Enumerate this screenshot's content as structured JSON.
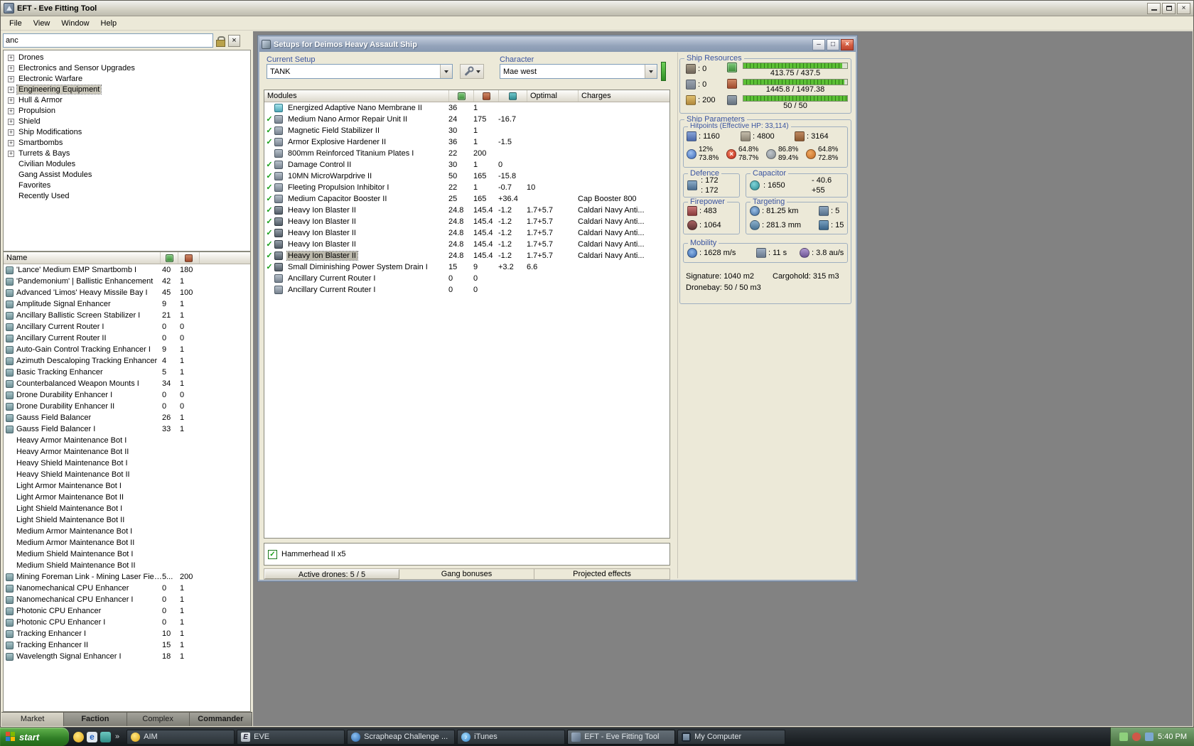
{
  "window": {
    "title": "EFT - Eve Fitting Tool",
    "menu": [
      "File",
      "View",
      "Window",
      "Help"
    ]
  },
  "sidebar": {
    "search_value": "anc",
    "tree": [
      {
        "label": "Drones",
        "exp": true
      },
      {
        "label": "Electronics and Sensor Upgrades",
        "exp": true
      },
      {
        "label": "Electronic Warfare",
        "exp": true
      },
      {
        "label": "Engineering Equipment",
        "exp": true,
        "selected": true
      },
      {
        "label": "Hull & Armor",
        "exp": true
      },
      {
        "label": "Propulsion",
        "exp": true
      },
      {
        "label": "Shield",
        "exp": true
      },
      {
        "label": "Ship Modifications",
        "exp": true
      },
      {
        "label": "Smartbombs",
        "exp": true
      },
      {
        "label": "Turrets & Bays",
        "exp": true
      },
      {
        "label": "Civilian Modules"
      },
      {
        "label": "Gang Assist Modules"
      },
      {
        "label": "Favorites"
      },
      {
        "label": "Recently Used"
      }
    ],
    "list": {
      "name_header": "Name",
      "items": [
        {
          "name": "'Lance' Medium EMP Smartbomb I",
          "v1": "40",
          "v2": "180"
        },
        {
          "name": "'Pandemonium' | Ballistic Enhancement",
          "v1": "42",
          "v2": "1"
        },
        {
          "name": "Advanced 'Limos' Heavy Missile Bay I",
          "v1": "45",
          "v2": "100"
        },
        {
          "name": "Amplitude Signal Enhancer",
          "v1": "9",
          "v2": "1"
        },
        {
          "name": "Ancillary Ballistic Screen Stabilizer I",
          "v1": "21",
          "v2": "1"
        },
        {
          "name": "Ancillary Current Router I",
          "v1": "0",
          "v2": "0"
        },
        {
          "name": "Ancillary Current Router II",
          "v1": "0",
          "v2": "0"
        },
        {
          "name": "Auto-Gain Control Tracking Enhancer I",
          "v1": "9",
          "v2": "1"
        },
        {
          "name": "Azimuth Descaloping Tracking Enhancer",
          "v1": "4",
          "v2": "1"
        },
        {
          "name": "Basic Tracking Enhancer",
          "v1": "5",
          "v2": "1"
        },
        {
          "name": "Counterbalanced Weapon Mounts I",
          "v1": "34",
          "v2": "1"
        },
        {
          "name": "Drone Durability Enhancer I",
          "v1": "0",
          "v2": "0"
        },
        {
          "name": "Drone Durability Enhancer II",
          "v1": "0",
          "v2": "0"
        },
        {
          "name": "Gauss Field Balancer",
          "v1": "26",
          "v2": "1"
        },
        {
          "name": "Gauss Field Balancer I",
          "v1": "33",
          "v2": "1"
        },
        {
          "name": "Heavy Armor Maintenance Bot I",
          "v1": "",
          "v2": "",
          "drone": true
        },
        {
          "name": "Heavy Armor Maintenance Bot II",
          "v1": "",
          "v2": "",
          "drone": true
        },
        {
          "name": "Heavy Shield Maintenance Bot I",
          "v1": "",
          "v2": "",
          "drone": true
        },
        {
          "name": "Heavy Shield Maintenance Bot II",
          "v1": "",
          "v2": "",
          "drone": true
        },
        {
          "name": "Light Armor Maintenance Bot I",
          "v1": "",
          "v2": "",
          "drone": true
        },
        {
          "name": "Light Armor Maintenance Bot II",
          "v1": "",
          "v2": "",
          "drone": true
        },
        {
          "name": "Light Shield Maintenance Bot I",
          "v1": "",
          "v2": "",
          "drone": true
        },
        {
          "name": "Light Shield Maintenance Bot II",
          "v1": "",
          "v2": "",
          "drone": true
        },
        {
          "name": "Medium Armor Maintenance Bot I",
          "v1": "",
          "v2": "",
          "drone": true
        },
        {
          "name": "Medium Armor Maintenance Bot II",
          "v1": "",
          "v2": "",
          "drone": true
        },
        {
          "name": "Medium Shield Maintenance Bot I",
          "v1": "",
          "v2": "",
          "drone": true
        },
        {
          "name": "Medium Shield Maintenance Bot II",
          "v1": "",
          "v2": "",
          "drone": true
        },
        {
          "name": "Mining Foreman Link - Mining Laser Field ...",
          "v1": "5...",
          "v2": "200"
        },
        {
          "name": "Nanomechanical CPU Enhancer",
          "v1": "0",
          "v2": "1"
        },
        {
          "name": "Nanomechanical CPU Enhancer I",
          "v1": "0",
          "v2": "1"
        },
        {
          "name": "Photonic CPU Enhancer",
          "v1": "0",
          "v2": "1"
        },
        {
          "name": "Photonic CPU Enhancer I",
          "v1": "0",
          "v2": "1"
        },
        {
          "name": "Tracking Enhancer I",
          "v1": "10",
          "v2": "1"
        },
        {
          "name": "Tracking Enhancer II",
          "v1": "15",
          "v2": "1"
        },
        {
          "name": "Wavelength Signal Enhancer I",
          "v1": "18",
          "v2": "1"
        }
      ]
    },
    "tabs": [
      {
        "label": "Market",
        "active": true
      },
      {
        "label": "Faction",
        "bold": true
      },
      {
        "label": "Complex"
      },
      {
        "label": "Commander",
        "bold": true
      }
    ]
  },
  "setup_window": {
    "title": "Setups for Deimos Heavy Assault Ship",
    "setup_label": "Current Setup",
    "setup_value": "TANK",
    "character_label": "Character",
    "character_value": "Mae west",
    "columns": {
      "modules": "Modules",
      "optimal": "Optimal",
      "charges": "Charges"
    },
    "modules": [
      {
        "name": "Energized Adaptive Nano Membrane II",
        "icon": "cyan",
        "cpu": "36",
        "pg": "1",
        "cap": "",
        "optimal": "",
        "charges": ""
      },
      {
        "check": true,
        "name": "Medium Nano Armor Repair Unit II",
        "icon": "gray",
        "cpu": "24",
        "pg": "175",
        "cap": "-16.7",
        "optimal": "",
        "charges": ""
      },
      {
        "check": true,
        "name": "Magnetic Field Stabilizer II",
        "icon": "gray",
        "cpu": "30",
        "pg": "1",
        "cap": "",
        "optimal": "",
        "charges": ""
      },
      {
        "check": true,
        "name": "Armor Explosive Hardener II",
        "icon": "gray",
        "cpu": "36",
        "pg": "1",
        "cap": "-1.5",
        "optimal": "",
        "charges": ""
      },
      {
        "name": "800mm Reinforced Titanium Plates I",
        "icon": "gray",
        "cpu": "22",
        "pg": "200",
        "cap": "",
        "optimal": "",
        "charges": ""
      },
      {
        "check": true,
        "name": "Damage Control II",
        "icon": "gray",
        "cpu": "30",
        "pg": "1",
        "cap": "0",
        "optimal": "",
        "charges": ""
      },
      {
        "check": true,
        "name": "10MN MicroWarpdrive II",
        "icon": "gray",
        "cpu": "50",
        "pg": "165",
        "cap": "-15.8",
        "optimal": "",
        "charges": ""
      },
      {
        "check": true,
        "name": "Fleeting Propulsion Inhibitor I",
        "icon": "gray",
        "cpu": "22",
        "pg": "1",
        "cap": "-0.7",
        "optimal": "10",
        "charges": ""
      },
      {
        "check": true,
        "name": "Medium Capacitor Booster II",
        "icon": "gray",
        "cpu": "25",
        "pg": "165",
        "cap": "+36.4",
        "optimal": "",
        "charges": "Cap Booster 800"
      },
      {
        "check": true,
        "name": "Heavy Ion Blaster II",
        "icon": "turret",
        "cpu": "24.8",
        "pg": "145.4",
        "cap": "-1.2",
        "optimal": "1.7+5.7",
        "charges": "Caldari Navy Anti..."
      },
      {
        "check": true,
        "name": "Heavy Ion Blaster II",
        "icon": "turret",
        "cpu": "24.8",
        "pg": "145.4",
        "cap": "-1.2",
        "optimal": "1.7+5.7",
        "charges": "Caldari Navy Anti..."
      },
      {
        "check": true,
        "name": "Heavy Ion Blaster II",
        "icon": "turret",
        "cpu": "24.8",
        "pg": "145.4",
        "cap": "-1.2",
        "optimal": "1.7+5.7",
        "charges": "Caldari Navy Anti..."
      },
      {
        "check": true,
        "name": "Heavy Ion Blaster II",
        "icon": "turret",
        "cpu": "24.8",
        "pg": "145.4",
        "cap": "-1.2",
        "optimal": "1.7+5.7",
        "charges": "Caldari Navy Anti..."
      },
      {
        "check": true,
        "name": "Heavy Ion Blaster II",
        "icon": "turret",
        "cpu": "24.8",
        "pg": "145.4",
        "cap": "-1.2",
        "optimal": "1.7+5.7",
        "charges": "Caldari Navy Anti...",
        "selected": true
      },
      {
        "check": true,
        "name": "Small Diminishing Power System Drain I",
        "icon": "turret",
        "cpu": "15",
        "pg": "9",
        "cap": "+3.2",
        "optimal": "6.6",
        "charges": ""
      },
      {
        "name": "Ancillary Current Router I",
        "icon": "gray",
        "cpu": "0",
        "pg": "0",
        "cap": "",
        "optimal": "",
        "charges": ""
      },
      {
        "name": "Ancillary Current Router I",
        "icon": "gray",
        "cpu": "0",
        "pg": "0",
        "cap": "",
        "optimal": "",
        "charges": ""
      }
    ],
    "drone_label": "Hammerhead II x5",
    "status": {
      "active_drones": "Active drones: 5 / 5",
      "gang": "Gang bonuses",
      "projected": "Projected effects"
    }
  },
  "stats": {
    "resources_label": "Ship Resources",
    "turrets": ": 0",
    "launchers": ": 0",
    "calibration": ": 200",
    "cpu": "413.75 / 437.5",
    "cpu_fill": 95,
    "powergrid": "1445.8 / 1497.38",
    "powergrid_fill": 97,
    "dronebay_bar": "50 / 50",
    "dronebay_fill": 100,
    "parameters_label": "Ship Parameters",
    "hitpoints_label": "Hitpoints (Effective HP: 33,114)",
    "shield_hp": ": 1160",
    "armor_hp": ": 4800",
    "hull_hp": ": 3164",
    "resists": [
      {
        "icon": "em",
        "top": "12%",
        "bottom": "73.8%"
      },
      {
        "icon": "thermal",
        "top": "64.8%",
        "bottom": "78.7%"
      },
      {
        "icon": "kinetic",
        "top": "86.8%",
        "bottom": "89.4%"
      },
      {
        "icon": "explosive",
        "top": "64.8%",
        "bottom": "72.8%"
      }
    ],
    "defence_label": "Defence",
    "defence_1": ": 172",
    "defence_2": ": 172",
    "capacitor_label": "Capacitor",
    "capacitor_amount": ": 1650",
    "capacitor_delta": "- 40.6",
    "capacitor_peak": "+55",
    "firepower_label": "Firepower",
    "volley": ": 483",
    "dps": ": 1064",
    "targeting_label": "Targeting",
    "range": ": 81.25 km",
    "max_targets": ": 5",
    "scan_res": ": 281.3 mm",
    "sensor_str": ": 15",
    "mobility_label": "Mobility",
    "speed": ": 1628 m/s",
    "align_time": ": 11 s",
    "warp_speed": ": 3.8 au/s",
    "signature": "Signature: 1040 m2",
    "cargohold": "Cargohold: 315 m3",
    "dronebay": "Dronebay: 50 / 50 m3"
  },
  "taskbar": {
    "start_label": "start",
    "overflow_glyph": "»",
    "tasks": [
      {
        "label": "AIM",
        "icon": "aim"
      },
      {
        "label": "EVE",
        "icon": "eve"
      },
      {
        "label": "Scrapheap Challenge ...",
        "icon": "globe"
      },
      {
        "label": "iTunes",
        "icon": "itunes"
      },
      {
        "label": "EFT - Eve Fitting Tool",
        "icon": "eft",
        "active": true
      },
      {
        "label": "My Computer",
        "icon": "computer"
      }
    ],
    "clock": "5:40 PM"
  }
}
